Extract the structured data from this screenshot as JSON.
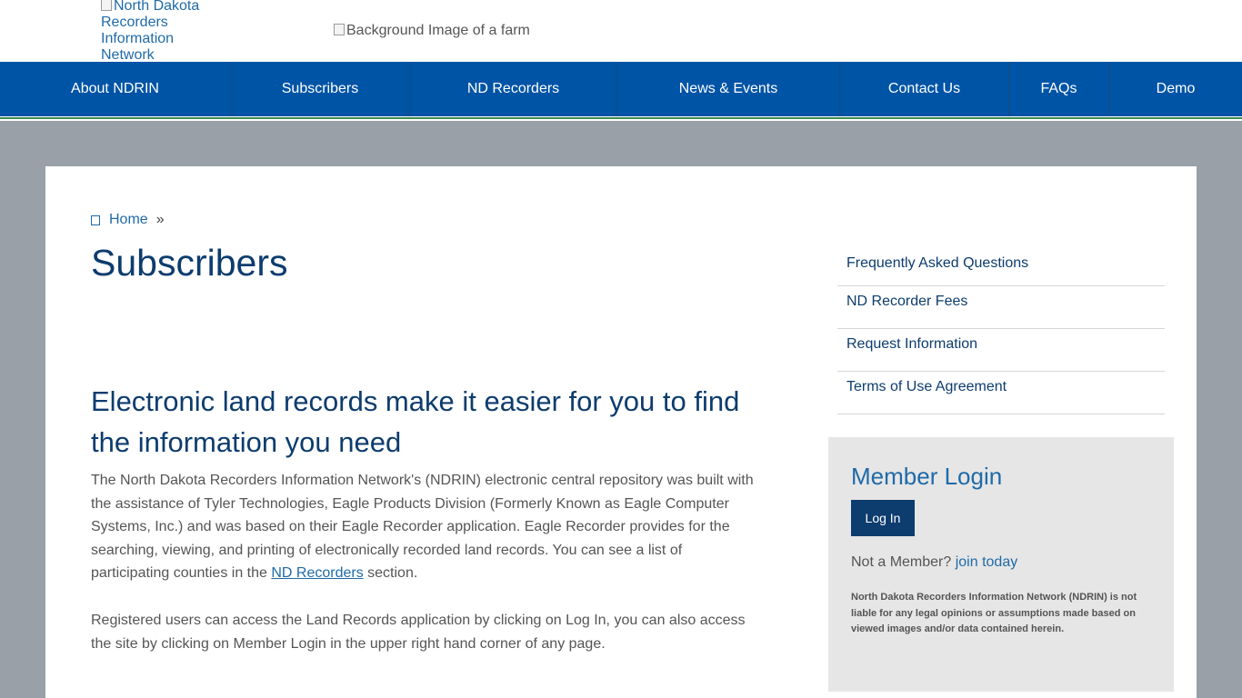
{
  "header": {
    "logo_alt": "North Dakota Recorders Information Network",
    "background_alt": "Background Image of a farm"
  },
  "nav": {
    "items": [
      {
        "label": "About NDRIN"
      },
      {
        "label": "Subscribers"
      },
      {
        "label": "ND Recorders"
      },
      {
        "label": "News & Events"
      },
      {
        "label": "Contact Us"
      },
      {
        "label": "FAQs"
      },
      {
        "label": "Demo"
      }
    ]
  },
  "breadcrumb": {
    "home_icon": "home-icon",
    "home": "Home",
    "separator": "»"
  },
  "main": {
    "title": "Subscribers",
    "heading": "Electronic land records make it easier for you to find the information you need",
    "p1_before_link": "The North Dakota Recorders Information Network's (NDRIN) electronic central repository was built with the assistance of Tyler Technologies, Eagle Products Division (Formerly Known as Eagle Computer Systems, Inc.) and was based on their Eagle Recorder application. Eagle Recorder provides for the searching, viewing, and printing of electronically recorded land records. You can see a list of participating counties in the ",
    "p1_link": "ND Recorders",
    "p1_after_link": " section.",
    "p2": "Registered users can access the Land Records application by clicking on Log In, you can also access the site by clicking on Member Login in the upper right hand corner of any page."
  },
  "sidebar": {
    "links": [
      {
        "label": "Frequently Asked Questions"
      },
      {
        "label": "ND Recorder Fees"
      },
      {
        "label": "Request Information"
      },
      {
        "label": "Terms of Use Agreement"
      }
    ]
  },
  "login": {
    "title": "Member Login",
    "button": "Log In",
    "not_member": "Not a Member?",
    "join": "join today",
    "disclaimer": "North Dakota Recorders Information Network (NDRIN) is not liable for any legal opinions or assumptions made based on viewed images and/or data contained herein."
  },
  "colors": {
    "nav_bg": "#0054a6",
    "title": "#0d3c6e",
    "link": "#1f6aa8",
    "accent_green": "#3c8c4a",
    "page_bg": "#9aa0a7",
    "login_bg": "#e6e6e6"
  }
}
